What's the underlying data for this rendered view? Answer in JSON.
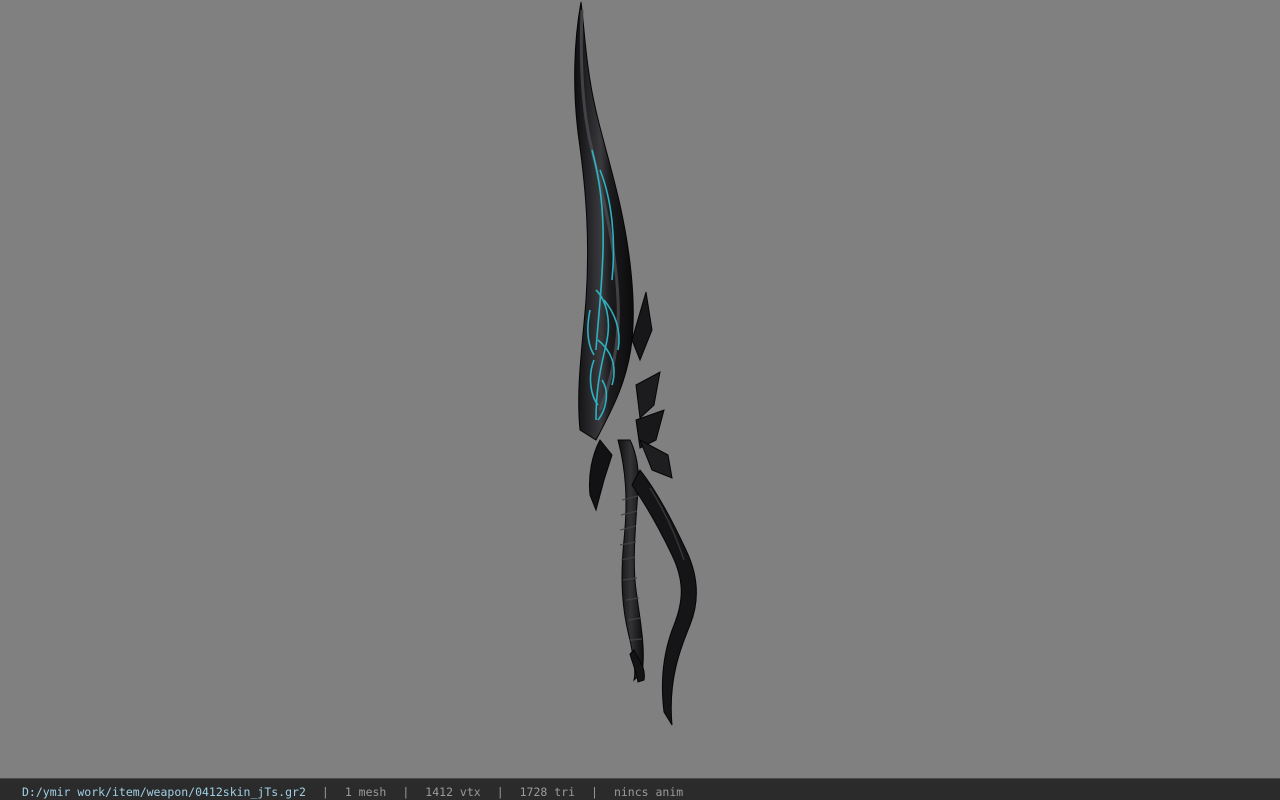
{
  "window": {
    "background_color": "#808080"
  },
  "viewport": {
    "model": "curved-blade-weapon",
    "glow_color": "#2fb8c8",
    "body_color": "#1a1a1c"
  },
  "statusbar": {
    "file_path": "D:/ymir work/item/weapon/0412skin_jTs.gr2",
    "separator": "|",
    "mesh_count": "1 mesh",
    "vertex_count": "1412 vtx",
    "triangle_count": "1728 tri",
    "animation": "nincs anim"
  }
}
